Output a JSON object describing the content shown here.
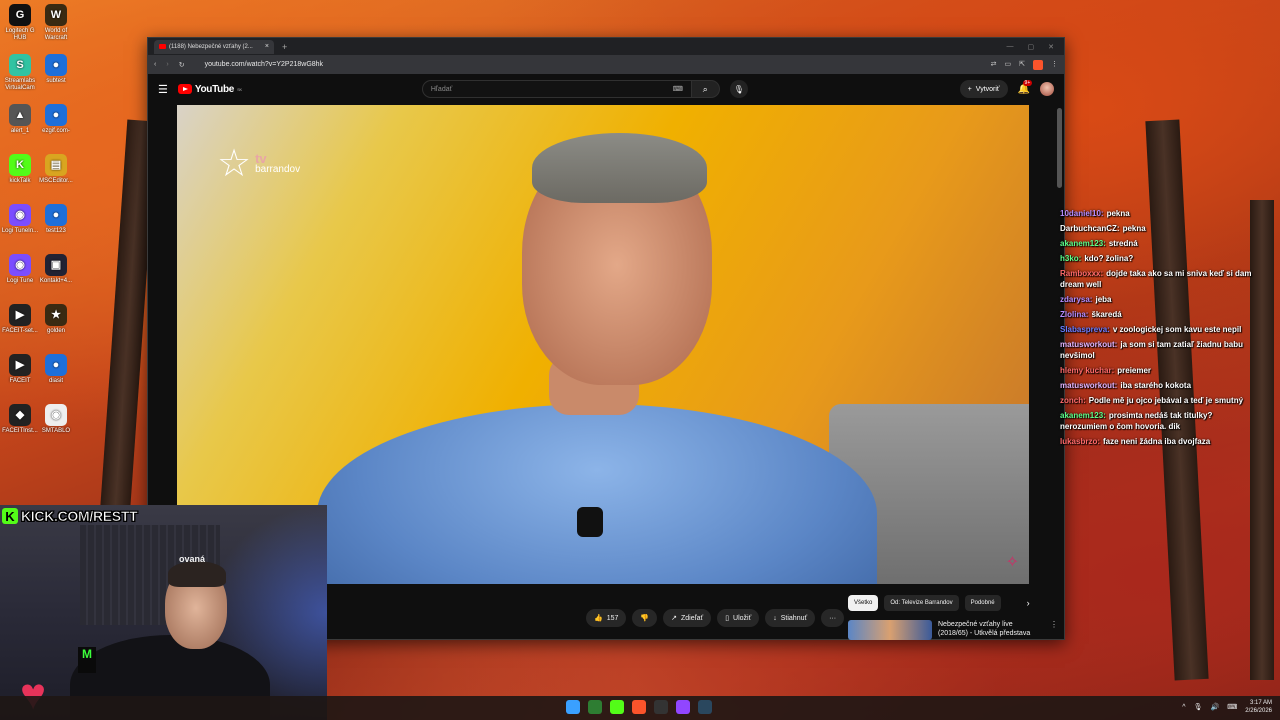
{
  "desktop": {
    "icons": [
      {
        "label": "Logitech G HUB",
        "glyph": "G",
        "color": "#111111"
      },
      {
        "label": "World of Warcraft",
        "glyph": "W",
        "color": "#3a2a12"
      },
      {
        "label": "Streamlabs VirtualCam",
        "glyph": "S",
        "color": "#31c3a2"
      },
      {
        "label": "subtest",
        "glyph": "●",
        "color": "#1e6fd9"
      },
      {
        "label": "alert_1",
        "glyph": "▲",
        "color": "#555555"
      },
      {
        "label": "ezgif.com-",
        "glyph": "●",
        "color": "#1e6fd9"
      },
      {
        "label": "kickTalk",
        "glyph": "K",
        "color": "#53fc18"
      },
      {
        "label": "MSCEditor...",
        "glyph": "▤",
        "color": "#d9a520"
      },
      {
        "label": "Logi TuneIn...",
        "glyph": "◉",
        "color": "#7b4dff"
      },
      {
        "label": "test123",
        "glyph": "●",
        "color": "#1e6fd9"
      },
      {
        "label": "Logi Tune",
        "glyph": "◉",
        "color": "#7b4dff"
      },
      {
        "label": "Kontakt+4...",
        "glyph": "▣",
        "color": "#222233"
      },
      {
        "label": "FACEIT-set...",
        "glyph": "▶",
        "color": "#222222"
      },
      {
        "label": "golden",
        "glyph": "★",
        "color": "#3a2a12"
      },
      {
        "label": "FACEIT",
        "glyph": "▶",
        "color": "#222222"
      },
      {
        "label": "diasit",
        "glyph": "●",
        "color": "#1e6fd9"
      },
      {
        "label": "FACEITInst...",
        "glyph": "◆",
        "color": "#222222"
      },
      {
        "label": "SMTABLO",
        "glyph": "◉",
        "color": "#eeeeee"
      }
    ]
  },
  "browser": {
    "tab_title": "(1188) Nebezpečné vzťahy (2...",
    "tab_close": "×",
    "new_tab": "+",
    "window_controls": [
      "—",
      "▢",
      "✕"
    ],
    "url": "youtube.com/watch?v=Y2P218wG8hk",
    "nav": {
      "back": "‹",
      "forward": "›",
      "reload": "↻"
    },
    "toolbar_icons": [
      "⇄",
      "▭",
      "⇱",
      "⋮"
    ]
  },
  "youtube": {
    "menu": "☰",
    "logo": "YouTube",
    "logo_region": "SK",
    "search_placeholder": "Hľadať",
    "search_icon": "⌕",
    "mic_icon": "🎙",
    "keyboard_icon": "⌨",
    "create_label": "Vytvoriť",
    "create_icon": "+",
    "notif_count": "9+",
    "bell_icon": "🔔",
    "video": {
      "channel_logo_tv": "tv",
      "channel_logo_brand": "barrandov",
      "title_fragment": "ovaná"
    },
    "actions": {
      "like_count": "157",
      "like_icon": "👍",
      "dislike_icon": "👎",
      "share": "Zdieľať",
      "save": "Uložiť",
      "download": "Stiahnuť",
      "more": "···"
    },
    "chips": [
      "Všetko",
      "Od: Televize Barrandov",
      "Podobné"
    ],
    "chip_next": "›",
    "recommendation": {
      "title_line1": "Nebezpečné vzťahy live",
      "title_line2": "(2018/65) - Utkvělá představa",
      "more": "⋮"
    }
  },
  "overlay": {
    "kick_handle": "KICK.COM/RESTT",
    "kick_k": "K"
  },
  "chat": {
    "messages": [
      {
        "user": "10daniel10:",
        "color": "#b48cff",
        "text": "pekna"
      },
      {
        "user": "DarbuchcanCZ:",
        "color": "#ffffff",
        "text": "pekna"
      },
      {
        "user": "akanem123:",
        "color": "#5cff8a",
        "text": "stredná"
      },
      {
        "user": "h3ko:",
        "color": "#5cff8a",
        "text": "kdo? žolina?"
      },
      {
        "user": "Ramboxxx:",
        "color": "#ff6a6a",
        "text": "dojde taka ako sa mi sniva keď si dam dream well"
      },
      {
        "user": "zdarysa:",
        "color": "#b48cff",
        "text": "jeba"
      },
      {
        "user": "Zlolina:",
        "color": "#b48cff",
        "text": "škaredá"
      },
      {
        "user": "Slabaspreva:",
        "color": "#6a7cff",
        "text": "v zoologickej som kavu este nepil"
      },
      {
        "user": "matusworkout:",
        "color": "#e0b4ff",
        "text": "ja som si tam zatiaľ žiadnu babu nevšimol"
      },
      {
        "user": "hlemy kuchar:",
        "color": "#ff6a6a",
        "text": "preiemer"
      },
      {
        "user": "matusworkout:",
        "color": "#e0b4ff",
        "text": "iba starého kokota"
      },
      {
        "user": "zonch:",
        "color": "#ff6a6a",
        "text": "Podle mě ju ojco jebával a teď je smutný"
      },
      {
        "user": "akanem123:",
        "color": "#5cff8a",
        "text": "prosimta nedáš tak titulky? nerozumiem o čom hovoria. dik"
      },
      {
        "user": "lukasbrzo:",
        "color": "#ff6a6a",
        "text": "faze neni žádna iba dvojfaza"
      }
    ]
  },
  "taskbar": {
    "icons": [
      {
        "name": "start",
        "color": "#3aa0ff"
      },
      {
        "name": "xbox",
        "color": "#2e7d32"
      },
      {
        "name": "kick",
        "color": "#53fc18"
      },
      {
        "name": "brave",
        "color": "#fb542b"
      },
      {
        "name": "obs",
        "color": "#333333"
      },
      {
        "name": "twitch",
        "color": "#9146ff"
      },
      {
        "name": "steam",
        "color": "#2a475e"
      }
    ],
    "tray_icons": [
      "^",
      "🎙",
      "🔊",
      "⌨"
    ],
    "time": "3:17 AM",
    "date": "2/26/2026"
  }
}
